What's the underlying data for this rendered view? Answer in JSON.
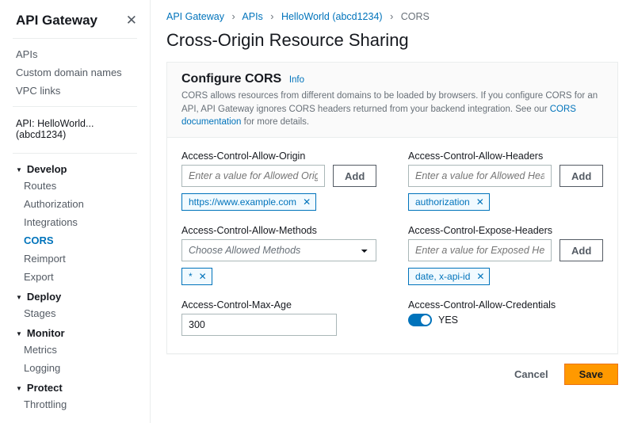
{
  "sidebar": {
    "title": "API Gateway",
    "top_links": [
      "APIs",
      "Custom domain names",
      "VPC links"
    ],
    "api_context": "API: HelloWorld...(abcd1234)",
    "groups": [
      {
        "name": "Develop",
        "items": [
          "Routes",
          "Authorization",
          "Integrations",
          "CORS",
          "Reimport",
          "Export"
        ],
        "active": "CORS"
      },
      {
        "name": "Deploy",
        "items": [
          "Stages"
        ]
      },
      {
        "name": "Monitor",
        "items": [
          "Metrics",
          "Logging"
        ]
      },
      {
        "name": "Protect",
        "items": [
          "Throttling"
        ]
      }
    ]
  },
  "breadcrumb": {
    "items": [
      "API Gateway",
      "APIs",
      "HelloWorld (abcd1234)"
    ],
    "current": "CORS"
  },
  "page": {
    "title": "Cross-Origin Resource Sharing",
    "panel_title": "Configure CORS",
    "info": "Info",
    "desc_1": "CORS allows resources from different domains to be loaded by browsers. If you configure CORS for an API, API Gateway ignores CORS headers returned from your backend integration. See our ",
    "desc_link": "CORS documentation",
    "desc_2": " for more details."
  },
  "fields": {
    "allow_origin": {
      "label": "Access-Control-Allow-Origin",
      "placeholder": "Enter a value for Allowed Origins",
      "add": "Add",
      "tags": [
        "https://www.example.com"
      ]
    },
    "allow_headers": {
      "label": "Access-Control-Allow-Headers",
      "placeholder": "Enter a value for Allowed Headers",
      "add": "Add",
      "tags": [
        "authorization"
      ]
    },
    "allow_methods": {
      "label": "Access-Control-Allow-Methods",
      "placeholder": "Choose Allowed Methods",
      "tags": [
        "*"
      ]
    },
    "expose_headers": {
      "label": "Access-Control-Expose-Headers",
      "placeholder": "Enter a value for Exposed Headers",
      "add": "Add",
      "tags": [
        "date, x-api-id"
      ]
    },
    "max_age": {
      "label": "Access-Control-Max-Age",
      "value": "300"
    },
    "allow_credentials": {
      "label": "Access-Control-Allow-Credentials",
      "value": "YES"
    }
  },
  "actions": {
    "cancel": "Cancel",
    "save": "Save"
  }
}
